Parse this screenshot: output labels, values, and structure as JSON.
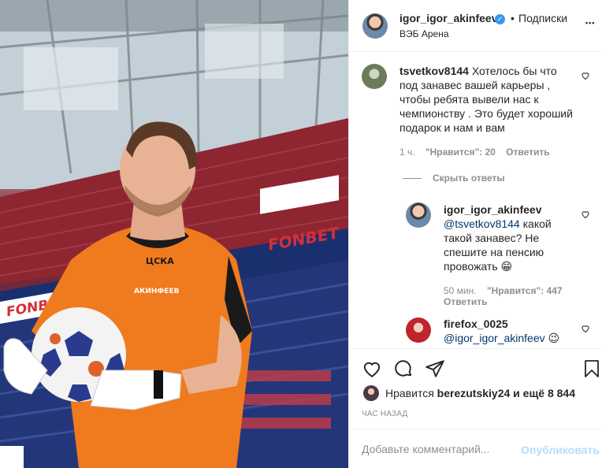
{
  "photo": {
    "banner_text": "FONBET",
    "shirt_club": "ЦСКА",
    "shirt_name": "АКИНФЕЕВ"
  },
  "header": {
    "username": "igor_igor_akinfeev",
    "verified_mark": "✓",
    "separator": "•",
    "follow_label": "Подписки",
    "location": "ВЭБ Арена",
    "more_label": "•••"
  },
  "comments": [
    {
      "username": "tsvetkov8144",
      "text": "Хотелось бы что под занавес вашей карьеры , чтобы ребята вывели нас к чемпионству . Это будет хороший подарок и нам и вам",
      "time": "1 ч.",
      "likes": "\"Нравится\": 20",
      "reply_label": "Ответить"
    }
  ],
  "hide_replies_label": "Скрыть ответы",
  "replies": [
    {
      "username": "igor_igor_akinfeev",
      "mention": "@tsvetkov8144",
      "text": " какой такой занавес? Не спешите на пенсию провожать 😁",
      "time": "50 мин.",
      "likes": "\"Нравится\": 447",
      "reply_label": "Ответить"
    },
    {
      "username": "firefox_0025",
      "mention": "@igor_igor_akinfeev",
      "text": " 😉"
    }
  ],
  "likes_line": {
    "prefix": "Нравится",
    "liker": "berezutskiy24",
    "suffix": "и ещё 8 844"
  },
  "time_ago": "ЧАС НАЗАД",
  "add_comment": {
    "placeholder": "Добавьте комментарий...",
    "publish_label": "Опубликовать"
  },
  "colors": {
    "accent": "#3897f0",
    "publish_disabled": "#b2dffc",
    "muted": "#8e8e8e",
    "shirt_orange": "#f07a1e"
  },
  "icons": {
    "heart": "heart-icon",
    "comment": "comment-icon",
    "share": "share-icon",
    "save": "bookmark-icon"
  }
}
